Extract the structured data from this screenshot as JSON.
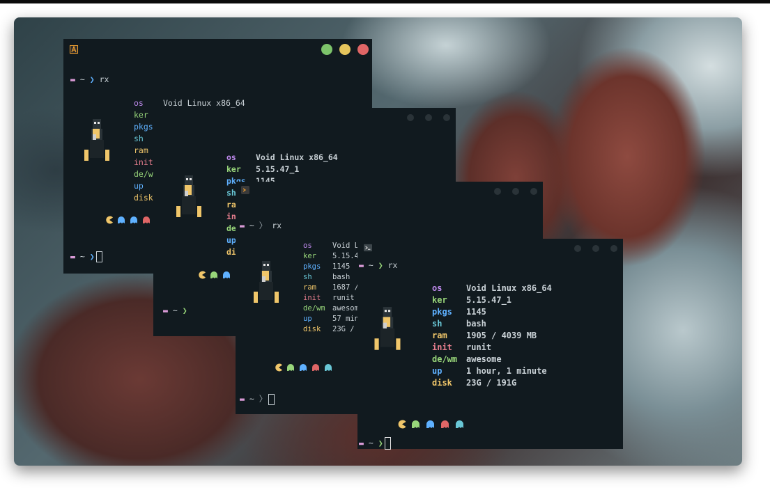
{
  "desktop": {
    "wallpaper": "rocks-and-sea"
  },
  "colors": {
    "terminal_bg": "#111a1f",
    "os": "#c18cf0",
    "ker": "#98d67a",
    "pkgs": "#5fb1ff",
    "sh": "#69c7d6",
    "ram": "#f0c66a",
    "init": "#e67e8e",
    "dewm": "#98d67a",
    "up": "#5fb1ff",
    "disk": "#f0c66a",
    "btn_green": "#7dc46b",
    "btn_yellow": "#e6c55c",
    "btn_red": "#e06666"
  },
  "terminals": [
    {
      "id": "t1",
      "app_icon": "alacritty-icon",
      "command": "rx",
      "labels": [
        "os",
        "ker",
        "pkgs",
        "sh",
        "ram",
        "init",
        "de/wm",
        "up",
        "disk"
      ],
      "os_value": "Void Linux x86_64",
      "prompt_folder": "▬",
      "prompt_tilde": "~",
      "prompt_chevron": "❯"
    },
    {
      "id": "t2",
      "labels": [
        "os",
        "ker",
        "pkgs",
        "sh",
        "ra",
        "in",
        "de",
        "up",
        "di"
      ],
      "values": [
        "Void Linux x86_64",
        "5.15.47_1",
        "1145"
      ],
      "prompt_tilde": "~",
      "prompt_chevron": "❯"
    },
    {
      "id": "t3",
      "command": "rx",
      "labels": [
        "os",
        "ker",
        "pkgs",
        "sh",
        "ram",
        "init",
        "de/wm",
        "up",
        "disk"
      ],
      "values": [
        "Void L",
        "5.15.4",
        "1145",
        "bash",
        "1687 /",
        "runit",
        "awesom",
        "57 min",
        "23G /"
      ],
      "prompt_tilde": "~",
      "prompt_chevron": "〉"
    },
    {
      "id": "t4",
      "command": "rx",
      "labels": [
        "os",
        "ker",
        "pkgs",
        "sh",
        "ram",
        "init",
        "de/wm",
        "up",
        "disk"
      ],
      "values": [
        "Void Linux x86_64",
        "5.15.47_1",
        "1145",
        "bash",
        "1905 / 4039 MB",
        "runit",
        "awesome",
        "1 hour, 1 minute",
        "23G / 191G"
      ],
      "prompt_tilde": "~",
      "prompt_chevron": "❯"
    }
  ]
}
